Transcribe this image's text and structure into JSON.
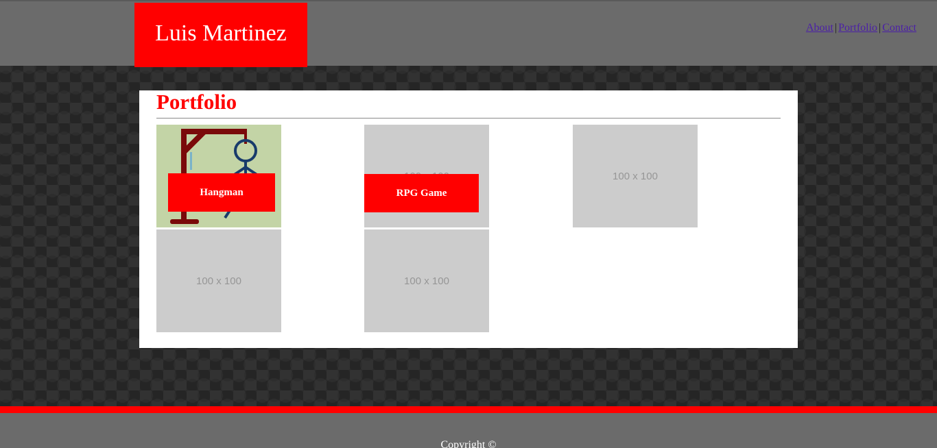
{
  "header": {
    "logo_text": "Luis Martinez",
    "nav": [
      {
        "label": "About"
      },
      {
        "label": "Portfolio"
      },
      {
        "label": "Contact"
      }
    ],
    "separator": "|"
  },
  "portfolio": {
    "title": "Portfolio",
    "items": [
      {
        "caption": "Hangman",
        "image": "hangman-thumbnail",
        "placeholder": ""
      },
      {
        "caption": "RPG Game",
        "image": "placeholder",
        "placeholder": "100 x 100"
      },
      {
        "caption": "",
        "image": "placeholder",
        "placeholder": "100 x 100"
      },
      {
        "caption": "",
        "image": "placeholder",
        "placeholder": "100 x 100"
      },
      {
        "caption": "",
        "image": "placeholder",
        "placeholder": "100 x 100"
      }
    ]
  },
  "footer": {
    "copyright": "Copyright ©"
  },
  "colors": {
    "accent": "#ff0000",
    "header_bg": "#6b6b6b",
    "panel_bg": "#ffffff",
    "placeholder_bg": "#cccccc",
    "link": "#4b1fa8"
  }
}
